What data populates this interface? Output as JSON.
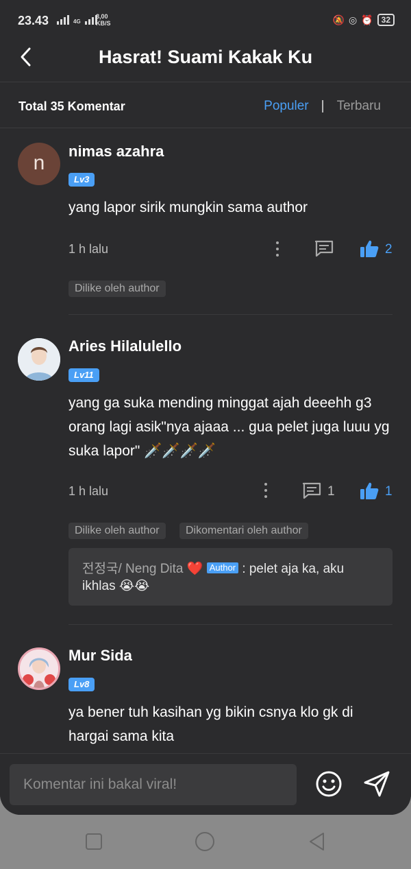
{
  "status": {
    "time": "23.43",
    "net_label": "4G",
    "speed_value": "3,00",
    "speed_unit": "KB/S",
    "battery": "32"
  },
  "header": {
    "title": "Hasrat! Suami Kakak Ku"
  },
  "subbar": {
    "total": "Total 35 Komentar",
    "sort_populer": "Populer",
    "sort_sep": "|",
    "sort_terbaru": "Terbaru"
  },
  "comments": [
    {
      "avatar_letter": "n",
      "name": "nimas azahra",
      "level": "Lv3",
      "text": "yang lapor sirik mungkin sama author",
      "time": "1 h lalu",
      "likes": "2",
      "tags": [
        "Dilike oleh author"
      ]
    },
    {
      "name": "Aries Hilalulello",
      "level": "Lv11",
      "text": "yang ga suka mending minggat ajah deeehh g3 orang lagi asik\"nya ajaaa    ... gua pelet juga luuu yg suka lapor\" 🗡️🗡️🗡️🗡️",
      "time": "1 h lalu",
      "replies": "1",
      "likes": "1",
      "tags": [
        "Dilike oleh author",
        "Dikomentari oleh author"
      ],
      "author_reply": {
        "name": "전정국/ Neng Dita ❤️",
        "badge": "Author",
        "text": ": pelet aja ka, aku ikhlas 😭😭"
      }
    },
    {
      "name": "Mur Sida",
      "level": "Lv8",
      "text": "ya bener tuh kasihan yg bikin csnya klo gk di hargai sama kita"
    }
  ],
  "input": {
    "placeholder": "Komentar ini bakal viral!"
  },
  "colors": {
    "accent": "#4a9ff5",
    "background": "#2b2b2d",
    "surface": "#3b3b3d"
  }
}
